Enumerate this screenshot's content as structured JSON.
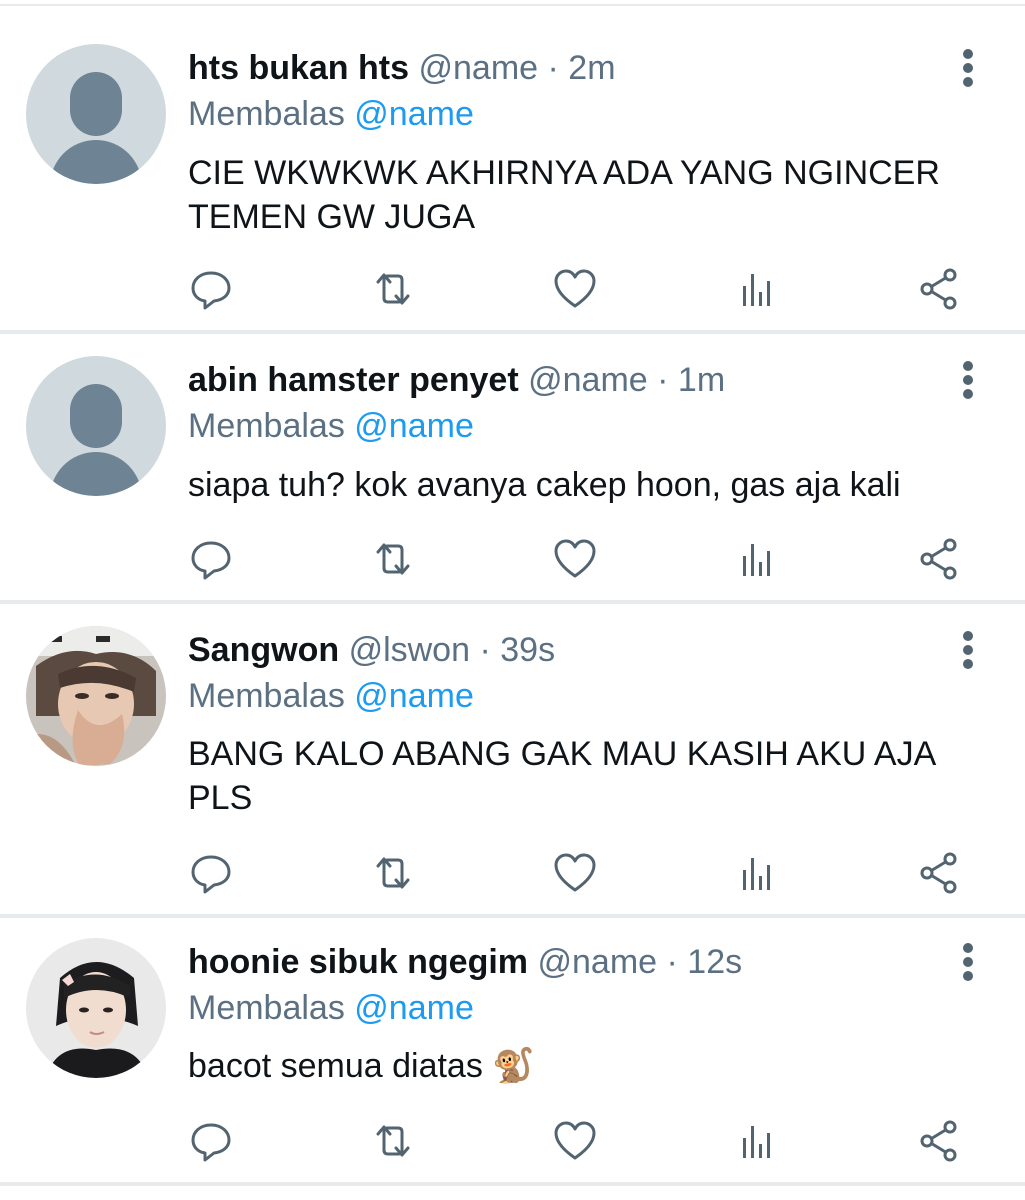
{
  "tweets": [
    {
      "display_name": "hts bukan hts",
      "handle": "@name",
      "sep": "·",
      "time": "2m",
      "reply_prefix": "Membalas",
      "reply_handle": "@name",
      "text": "CIE WKWKWK AKHIRNYA ADA YANG NGINCER TEMEN GW JUGA",
      "avatar": "default-avatar"
    },
    {
      "display_name": "abin hamster penyet",
      "handle": "@name",
      "sep": "·",
      "time": "1m",
      "reply_prefix": "Membalas",
      "reply_handle": "@name",
      "text": "siapa tuh? kok avanya cakep hoon, gas aja kali",
      "avatar": "default-avatar"
    },
    {
      "display_name": "Sangwon",
      "handle": "@lswon",
      "sep": "·",
      "time": "39s",
      "reply_prefix": "Membalas",
      "reply_handle": "@name",
      "text": "BANG KALO ABANG GAK MAU KASIH AKU AJA PLS",
      "avatar": "photo-avatar"
    },
    {
      "display_name": "hoonie sibuk ngegim",
      "handle": "@name",
      "sep": "·",
      "time": "12s",
      "reply_prefix": "Membalas",
      "reply_handle": "@name",
      "text": "bacot semua diatas 🐒",
      "avatar": "photo-avatar"
    }
  ],
  "actions": [
    "reply-icon",
    "retweet-icon",
    "like-icon",
    "analytics-icon",
    "share-icon"
  ],
  "colors": {
    "text": "#0f1419",
    "meta": "#5b7083",
    "link": "#1d9bf0",
    "icon": "#536471",
    "divider": "#e8ebed",
    "default_avatar_bg": "#cfd9de",
    "default_avatar_fg": "#6e8393"
  }
}
